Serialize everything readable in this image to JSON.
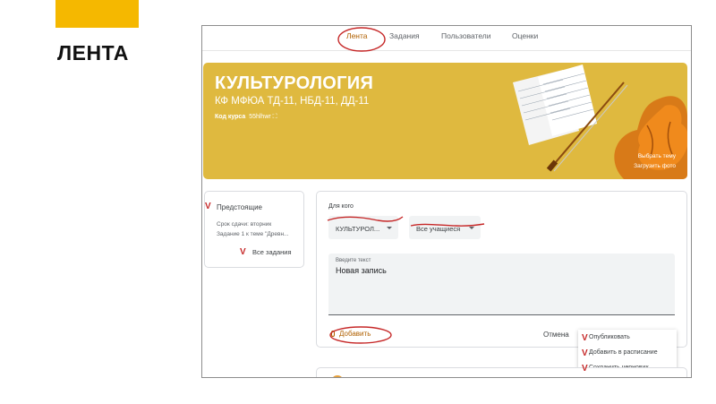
{
  "slide": {
    "title": "ЛЕНТА"
  },
  "nav": {
    "tabs": [
      "Лента",
      "Задания",
      "Пользователи",
      "Оценки"
    ]
  },
  "banner": {
    "title": "КУЛЬТУРОЛОГИЯ",
    "subtitle": "КФ МФЮА ТД-11, НБД-11, ДД-11",
    "code_label": "Код курса",
    "code_value": "55hlhwr ⛶",
    "select_theme": "Выбрать тему",
    "upload_photo": "Загрузить фото"
  },
  "upcoming": {
    "title": "Предстоящие",
    "due": "Срок сдачи: вторник",
    "task": "Задание 1 к теме \"Древн...",
    "all_tasks": "Все задания"
  },
  "composer": {
    "for_whom": "Для кого",
    "course_select": "КУЛЬТУРОЛ...",
    "students_select": "Все учащиеся",
    "text_placeholder": "Введите текст",
    "text_value": "Новая запись",
    "add_button": "Добавить",
    "cancel_button": "Отмена"
  },
  "post_menu": {
    "items": [
      "Опубликовать",
      "Добавить в расписание",
      "Сохранить черновик"
    ]
  },
  "annotation_mark": "V",
  "colors": {
    "accent": "#f5b800",
    "banner": "#dfb93f",
    "link": "#b06000",
    "annotation": "#c62828"
  }
}
